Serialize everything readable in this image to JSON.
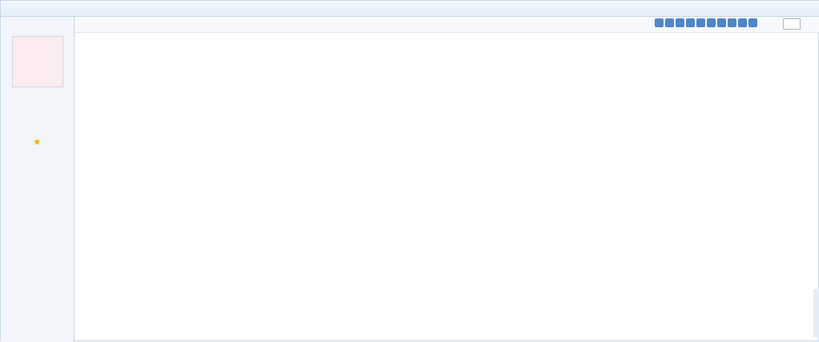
{
  "topbar": {},
  "sidebar": {},
  "meta": {},
  "post": {}
}
